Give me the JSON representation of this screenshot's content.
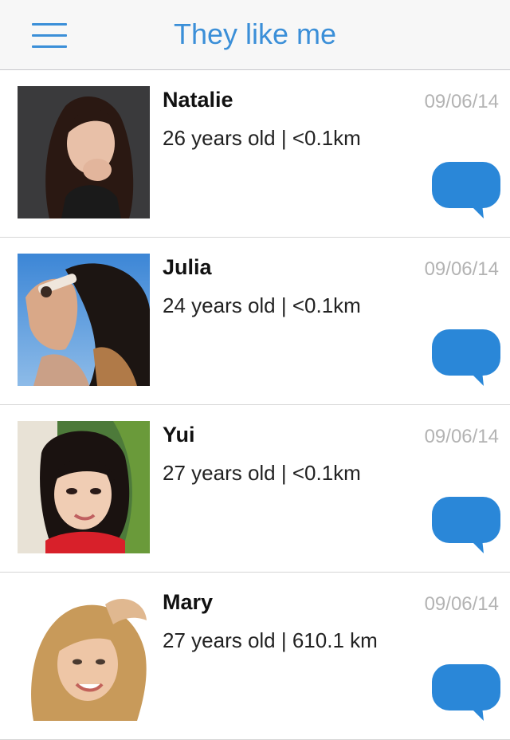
{
  "header": {
    "title": "They like me",
    "menu_icon": "hamburger-menu-icon"
  },
  "colors": {
    "accent": "#3b8fd8",
    "chat_bubble": "#2a87d8",
    "date_text": "#b3b3b3"
  },
  "items": [
    {
      "name": "Natalie",
      "info": "26 years old | <0.1km",
      "date": "09/06/14"
    },
    {
      "name": "Julia",
      "info": "24 years old | <0.1km",
      "date": "09/06/14"
    },
    {
      "name": "Yui",
      "info": "27 years old | <0.1km",
      "date": "09/06/14"
    },
    {
      "name": "Mary",
      "info": "27 years old | 610.1 km",
      "date": "09/06/14"
    }
  ]
}
